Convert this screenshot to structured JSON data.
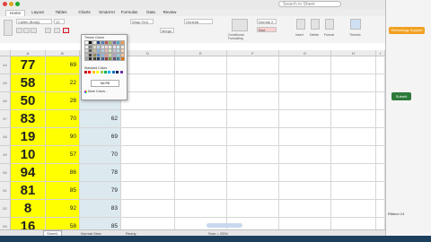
{
  "window": {
    "search_placeholder": "Search in Sheet"
  },
  "tabs": [
    "Home",
    "Layout",
    "Tables",
    "Charts",
    "SmartArt",
    "Formulas",
    "Data",
    "Review"
  ],
  "ribbon": {
    "font_name": "Calibri (Body)",
    "font_size": "12",
    "wrap_text": "Wrap Text",
    "number_format": "General",
    "merge": "Merge",
    "style_name": "Normal 2",
    "style_bad": "Bad",
    "conditional_formatting": "Conditional Formatting",
    "insert": "Insert",
    "delete": "Delete",
    "format": "Format",
    "themes": "Themes"
  },
  "color_popup": {
    "theme_colors_label": "Theme Colors",
    "standard_colors_label": "Standard Colors",
    "no_fill_label": "No Fill",
    "more_colors_label": "More Colors..."
  },
  "columns": [
    "A",
    "B",
    "C",
    "D",
    "E",
    "F",
    "G",
    "H",
    "I"
  ],
  "rows": [
    {
      "num": "44",
      "a": "77",
      "b": "69",
      "c": ""
    },
    {
      "num": "45",
      "a": "58",
      "b": "22",
      "c": ""
    },
    {
      "num": "46",
      "a": "50",
      "b": "28",
      "c": ""
    },
    {
      "num": "47",
      "a": "83",
      "b": "70",
      "c": "62"
    },
    {
      "num": "48",
      "a": "19",
      "b": "90",
      "c": "69"
    },
    {
      "num": "49",
      "a": "10",
      "b": "57",
      "c": "70"
    },
    {
      "num": "50",
      "a": "94",
      "b": "86",
      "c": "78"
    },
    {
      "num": "51",
      "a": "81",
      "b": "85",
      "c": "79"
    },
    {
      "num": "52",
      "a": "8",
      "b": "92",
      "c": "83"
    },
    {
      "num": "53",
      "a": "16",
      "b": "58",
      "c": "85"
    }
  ],
  "status": {
    "view": "Normal View",
    "ready": "Ready",
    "sheet_tab": "Sheet1",
    "sum_text": "Sum = 2334"
  },
  "right_panel": {
    "banner": "Technology Support",
    "submit": "Submit",
    "ribbon_label": "Ribbon 14"
  },
  "colors": {
    "yellow": "#ffff00",
    "lightblue": "#dce9ef",
    "green_button": "#2d7a3a",
    "orange": "#f0a020"
  }
}
